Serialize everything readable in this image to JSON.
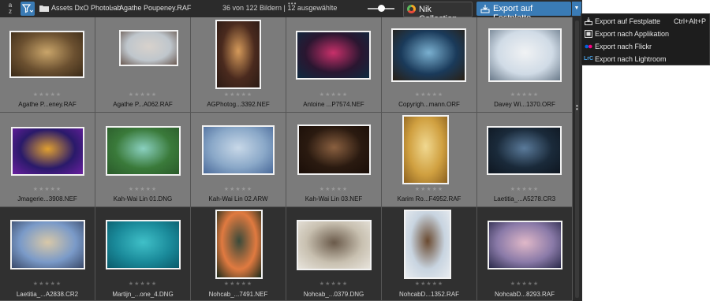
{
  "toolbar": {
    "sort_label": "a\nz",
    "breadcrumb": [
      "Assets DxO PhotoLab",
      "Agathe Poupeney.RAF"
    ],
    "count_text": "36 von 122 Bildern | 12 ausgewählte",
    "zoom_level": 0.5,
    "nik_label": "Nik Collection",
    "export_label": "Export auf Festplatte"
  },
  "rating_stars": "★★★★★",
  "thumbnails": [
    {
      "name": "Agathe P...eney.RAF",
      "colors": [
        "#6b5030",
        "#c9a56a",
        "#3a2a18"
      ]
    },
    {
      "name": "Agathe P...A062.RAF",
      "colors": [
        "#bfc6cc",
        "#d8d2cc",
        "#6a5a52"
      ]
    },
    {
      "name": "AGPhotog...3392.NEF",
      "colors": [
        "#4a2a1e",
        "#d59a5a",
        "#2a1a14"
      ]
    },
    {
      "name": "Antoine ...P7574.NEF",
      "colors": [
        "#2a1630",
        "#c8306a",
        "#0e2a40"
      ]
    },
    {
      "name": "Copyrigh...mann.ORF",
      "colors": [
        "#1a3a5a",
        "#7ab0d0",
        "#2a2014"
      ]
    },
    {
      "name": "Davey Wi...1370.ORF",
      "colors": [
        "#d0dbe6",
        "#f0f2f4",
        "#6a7a8a"
      ]
    },
    {
      "name": "Jmagerie...3908.NEF",
      "colors": [
        "#2a1a6a",
        "#e0a030",
        "#6a20a0"
      ]
    },
    {
      "name": "Kah-Wai Lin 01.DNG",
      "colors": [
        "#3a7a3a",
        "#8ad0c0",
        "#2a5a2a"
      ]
    },
    {
      "name": "Kah-Wai Lin 02.ARW",
      "colors": [
        "#8aa8c8",
        "#c8d8e8",
        "#4a6a9a"
      ]
    },
    {
      "name": "Kah-Wai Lin 03.NEF",
      "colors": [
        "#2a1a10",
        "#8a6040",
        "#1a0e08"
      ]
    },
    {
      "name": "Karim Ro...F4952.RAF",
      "colors": [
        "#d0a040",
        "#f0d890",
        "#8a6020"
      ]
    },
    {
      "name": "Laetitia_...A5278.CR3",
      "colors": [
        "#1a2a3a",
        "#5a7a9a",
        "#0e1620"
      ]
    },
    {
      "name": "Laetitia_...A2838.CR2",
      "colors": [
        "#7a9ac8",
        "#d8c8a8",
        "#3a4a6a"
      ]
    },
    {
      "name": "Martijn_...one_4.DNG",
      "colors": [
        "#1a8a9a",
        "#40c0c8",
        "#0a5a6a"
      ]
    },
    {
      "name": "Nohcab_...7491.NEF",
      "colors": [
        "#e07a40",
        "#3a4a3a",
        "#1a2a1a"
      ]
    },
    {
      "name": "Nohcab_...0379.DNG",
      "colors": [
        "#c8c0b0",
        "#6a5a4a",
        "#e8e4dc"
      ]
    },
    {
      "name": "NohcabD...1352.RAF",
      "colors": [
        "#c8d4e0",
        "#6a4a30",
        "#e8ecf0"
      ]
    },
    {
      "name": "NohcabD...8293.RAF",
      "colors": [
        "#8a7aa8",
        "#e0b8c8",
        "#2a2a4a"
      ]
    }
  ],
  "menu": [
    {
      "label": "Export auf Festplatte",
      "shortcut": "Ctrl+Alt+P",
      "icon": "export-disk-icon"
    },
    {
      "label": "Export nach Applikation",
      "shortcut": "",
      "icon": "export-app-icon"
    },
    {
      "label": "Export nach Flickr",
      "shortcut": "",
      "icon": "flickr-icon"
    },
    {
      "label": "Export nach Lightroom",
      "shortcut": "",
      "icon": "lightroom-icon",
      "badge": "LrC"
    }
  ]
}
